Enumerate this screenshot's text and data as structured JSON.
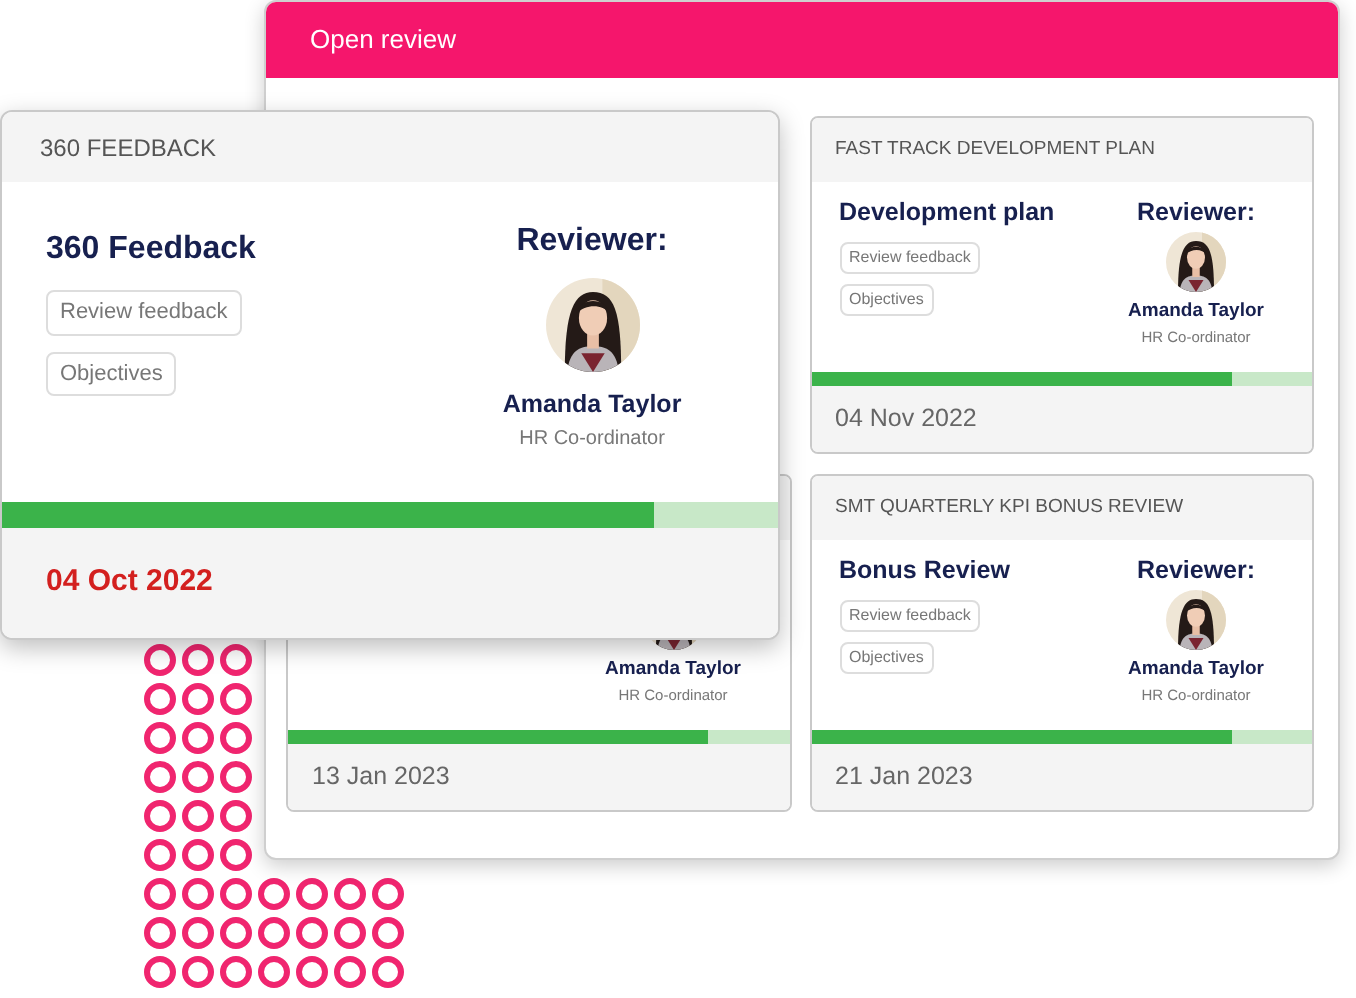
{
  "window": {
    "title": "Open review"
  },
  "cards": [
    {
      "header": "FAST TRACK DEVELOPMENT PLAN",
      "title": "Development plan",
      "tags": [
        "Review feedback",
        "Objectives"
      ],
      "reviewer_label": "Reviewer:",
      "reviewer_name": "Amanda Taylor",
      "reviewer_role": "HR Co-ordinator",
      "level": 0.84,
      "date": "04 Nov 2022"
    },
    {
      "reviewer_name": "Amanda Taylor",
      "reviewer_role": "HR Co-ordinator",
      "level": 0.84,
      "date": "13 Jan 2023"
    },
    {
      "header": "SMT QUARTERLY KPI BONUS REVIEW",
      "title": "Bonus Review",
      "tags": [
        "Review feedback",
        "Objectives"
      ],
      "reviewer_label": "Reviewer:",
      "reviewer_name": "Amanda Taylor",
      "reviewer_role": "HR Co-ordinator",
      "level": 0.84,
      "date": "21 Jan 2023"
    }
  ],
  "front_card": {
    "header": "360 FEEDBACK",
    "title": "360 Feedback",
    "tags": [
      "Review feedback",
      "Objectives"
    ],
    "reviewer_label": "Reviewer:",
    "reviewer_name": "Amanda Taylor",
    "reviewer_role": "HR Co-ordinator",
    "level": 0.84,
    "date": "04 Oct 2022",
    "overdue": true
  }
}
